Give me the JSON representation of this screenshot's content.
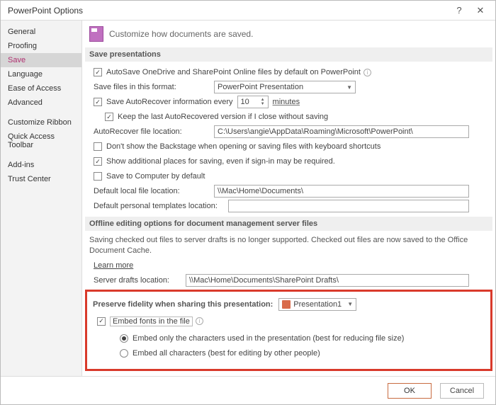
{
  "window": {
    "title": "PowerPoint Options"
  },
  "sidebar": {
    "items": [
      "General",
      "Proofing",
      "Save",
      "Language",
      "Ease of Access",
      "Advanced",
      "Customize Ribbon",
      "Quick Access Toolbar",
      "Add-ins",
      "Trust Center"
    ],
    "selected": "Save"
  },
  "header": {
    "text": "Customize how documents are saved."
  },
  "sections": {
    "save_presentations": {
      "title": "Save presentations",
      "autosave": "AutoSave OneDrive and SharePoint Online files by default on PowerPoint",
      "format_label": "Save files in this format:",
      "format_value": "PowerPoint Presentation",
      "autorecover_label": "Save AutoRecover information every",
      "autorecover_value": "10",
      "autorecover_unit": "minutes",
      "keep_last": "Keep the last AutoRecovered version if I close without saving",
      "ar_loc_label": "AutoRecover file location:",
      "ar_loc_value": "C:\\Users\\angie\\AppData\\Roaming\\Microsoft\\PowerPoint\\",
      "backstage": "Don't show the Backstage when opening or saving files with keyboard shortcuts",
      "addl_places": "Show additional places for saving, even if sign-in may be required.",
      "save_computer": "Save to Computer by default",
      "local_label": "Default local file location:",
      "local_value": "\\\\Mac\\Home\\Documents\\",
      "tpl_label": "Default personal templates location:",
      "tpl_value": ""
    },
    "offline": {
      "title": "Offline editing options for document management server files",
      "para": "Saving checked out files to server drafts is no longer supported. Checked out files are now saved to the Office Document Cache.",
      "learn": "Learn more",
      "drafts_label": "Server drafts location:",
      "drafts_value": "\\\\Mac\\Home\\Documents\\SharePoint Drafts\\"
    },
    "preserve": {
      "title": "Preserve fidelity when sharing this presentation:",
      "doc_value": "Presentation1",
      "embed": "Embed fonts in the file",
      "opt_only": "Embed only the characters used in the presentation (best for reducing file size)",
      "opt_all": "Embed all characters (best for editing by other people)"
    }
  },
  "footer": {
    "ok": "OK",
    "cancel": "Cancel"
  }
}
